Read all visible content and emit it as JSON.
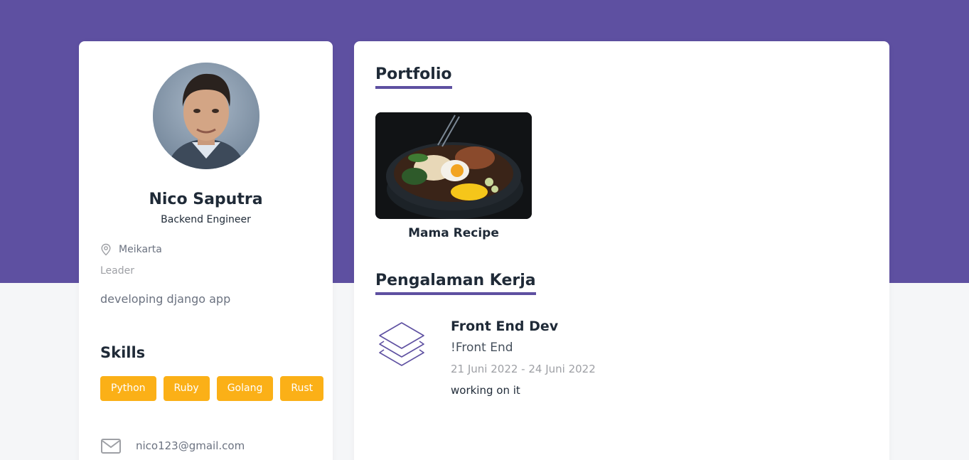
{
  "colors": {
    "header_band": "#5e50a1",
    "page_background": "#f5f6f8",
    "card_background": "#ffffff",
    "skill_tag": "#fbb017",
    "section_underline": "#5e50a1"
  },
  "profile": {
    "avatar_icon": "avatar-photo",
    "name": "Nico Saputra",
    "role": "Backend Engineer",
    "location_icon": "map-pin-icon",
    "location": "Meikarta",
    "job_status": "Leader",
    "bio": "developing django app",
    "skills_title": "Skills",
    "skills": [
      "Python",
      "Ruby",
      "Golang",
      "Rust"
    ],
    "email_icon": "mail-icon",
    "email": "nico123@gmail.com"
  },
  "portfolio": {
    "title": "Portfolio",
    "items": [
      {
        "name": "Mama Recipe",
        "image": "ramen-bowl-photo"
      }
    ]
  },
  "experience": {
    "title": "Pengalaman Kerja",
    "items": [
      {
        "logo_icon": "layers-icon",
        "position": "Front End Dev",
        "company": "!Front End",
        "dates": "21 Juni 2022 - 24 Juni 2022",
        "description": "working on it"
      }
    ]
  }
}
